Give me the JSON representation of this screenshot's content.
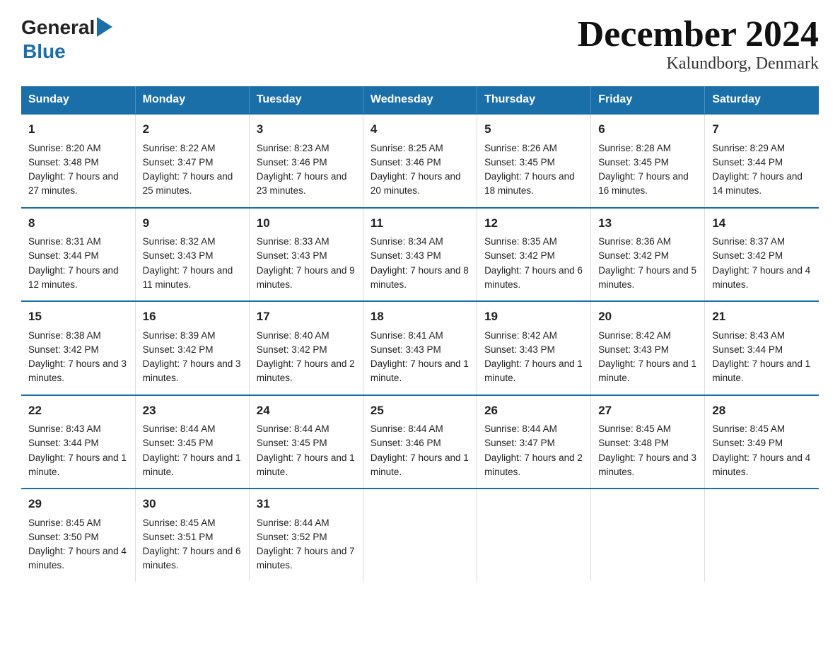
{
  "header": {
    "logo_general": "General",
    "logo_blue": "Blue",
    "title": "December 2024",
    "subtitle": "Kalundborg, Denmark"
  },
  "days_of_week": [
    "Sunday",
    "Monday",
    "Tuesday",
    "Wednesday",
    "Thursday",
    "Friday",
    "Saturday"
  ],
  "weeks": [
    [
      {
        "day": "1",
        "sunrise": "8:20 AM",
        "sunset": "3:48 PM",
        "daylight": "7 hours and 27 minutes."
      },
      {
        "day": "2",
        "sunrise": "8:22 AM",
        "sunset": "3:47 PM",
        "daylight": "7 hours and 25 minutes."
      },
      {
        "day": "3",
        "sunrise": "8:23 AM",
        "sunset": "3:46 PM",
        "daylight": "7 hours and 23 minutes."
      },
      {
        "day": "4",
        "sunrise": "8:25 AM",
        "sunset": "3:46 PM",
        "daylight": "7 hours and 20 minutes."
      },
      {
        "day": "5",
        "sunrise": "8:26 AM",
        "sunset": "3:45 PM",
        "daylight": "7 hours and 18 minutes."
      },
      {
        "day": "6",
        "sunrise": "8:28 AM",
        "sunset": "3:45 PM",
        "daylight": "7 hours and 16 minutes."
      },
      {
        "day": "7",
        "sunrise": "8:29 AM",
        "sunset": "3:44 PM",
        "daylight": "7 hours and 14 minutes."
      }
    ],
    [
      {
        "day": "8",
        "sunrise": "8:31 AM",
        "sunset": "3:44 PM",
        "daylight": "7 hours and 12 minutes."
      },
      {
        "day": "9",
        "sunrise": "8:32 AM",
        "sunset": "3:43 PM",
        "daylight": "7 hours and 11 minutes."
      },
      {
        "day": "10",
        "sunrise": "8:33 AM",
        "sunset": "3:43 PM",
        "daylight": "7 hours and 9 minutes."
      },
      {
        "day": "11",
        "sunrise": "8:34 AM",
        "sunset": "3:43 PM",
        "daylight": "7 hours and 8 minutes."
      },
      {
        "day": "12",
        "sunrise": "8:35 AM",
        "sunset": "3:42 PM",
        "daylight": "7 hours and 6 minutes."
      },
      {
        "day": "13",
        "sunrise": "8:36 AM",
        "sunset": "3:42 PM",
        "daylight": "7 hours and 5 minutes."
      },
      {
        "day": "14",
        "sunrise": "8:37 AM",
        "sunset": "3:42 PM",
        "daylight": "7 hours and 4 minutes."
      }
    ],
    [
      {
        "day": "15",
        "sunrise": "8:38 AM",
        "sunset": "3:42 PM",
        "daylight": "7 hours and 3 minutes."
      },
      {
        "day": "16",
        "sunrise": "8:39 AM",
        "sunset": "3:42 PM",
        "daylight": "7 hours and 3 minutes."
      },
      {
        "day": "17",
        "sunrise": "8:40 AM",
        "sunset": "3:42 PM",
        "daylight": "7 hours and 2 minutes."
      },
      {
        "day": "18",
        "sunrise": "8:41 AM",
        "sunset": "3:43 PM",
        "daylight": "7 hours and 1 minute."
      },
      {
        "day": "19",
        "sunrise": "8:42 AM",
        "sunset": "3:43 PM",
        "daylight": "7 hours and 1 minute."
      },
      {
        "day": "20",
        "sunrise": "8:42 AM",
        "sunset": "3:43 PM",
        "daylight": "7 hours and 1 minute."
      },
      {
        "day": "21",
        "sunrise": "8:43 AM",
        "sunset": "3:44 PM",
        "daylight": "7 hours and 1 minute."
      }
    ],
    [
      {
        "day": "22",
        "sunrise": "8:43 AM",
        "sunset": "3:44 PM",
        "daylight": "7 hours and 1 minute."
      },
      {
        "day": "23",
        "sunrise": "8:44 AM",
        "sunset": "3:45 PM",
        "daylight": "7 hours and 1 minute."
      },
      {
        "day": "24",
        "sunrise": "8:44 AM",
        "sunset": "3:45 PM",
        "daylight": "7 hours and 1 minute."
      },
      {
        "day": "25",
        "sunrise": "8:44 AM",
        "sunset": "3:46 PM",
        "daylight": "7 hours and 1 minute."
      },
      {
        "day": "26",
        "sunrise": "8:44 AM",
        "sunset": "3:47 PM",
        "daylight": "7 hours and 2 minutes."
      },
      {
        "day": "27",
        "sunrise": "8:45 AM",
        "sunset": "3:48 PM",
        "daylight": "7 hours and 3 minutes."
      },
      {
        "day": "28",
        "sunrise": "8:45 AM",
        "sunset": "3:49 PM",
        "daylight": "7 hours and 4 minutes."
      }
    ],
    [
      {
        "day": "29",
        "sunrise": "8:45 AM",
        "sunset": "3:50 PM",
        "daylight": "7 hours and 4 minutes."
      },
      {
        "day": "30",
        "sunrise": "8:45 AM",
        "sunset": "3:51 PM",
        "daylight": "7 hours and 6 minutes."
      },
      {
        "day": "31",
        "sunrise": "8:44 AM",
        "sunset": "3:52 PM",
        "daylight": "7 hours and 7 minutes."
      },
      null,
      null,
      null,
      null
    ]
  ]
}
